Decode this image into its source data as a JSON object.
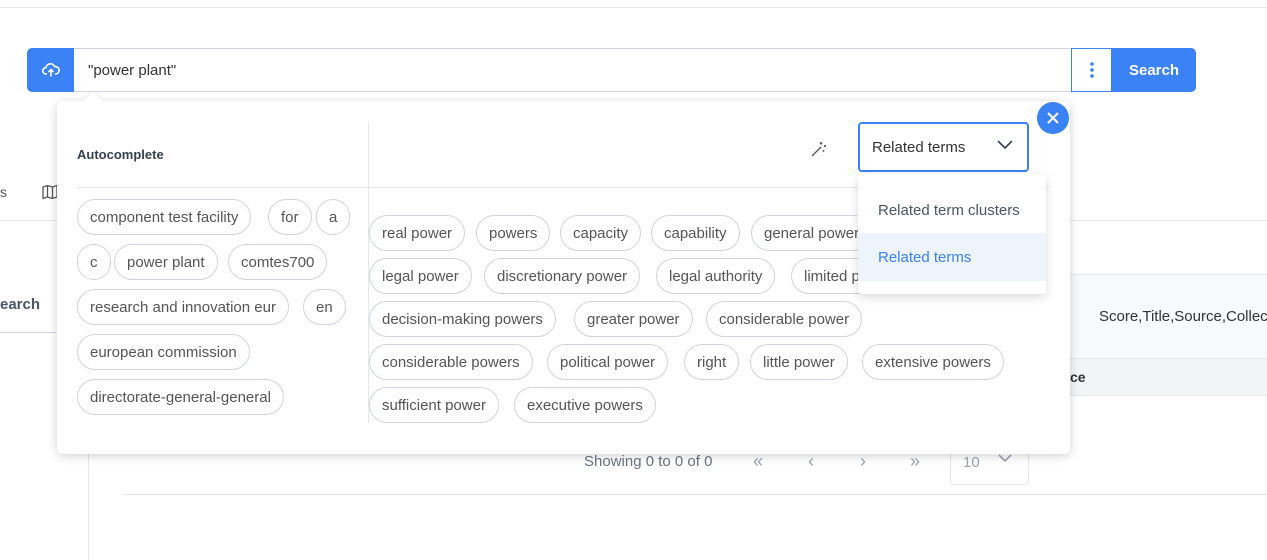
{
  "colors": {
    "accent": "#3b82f6",
    "selected_bg": "#eef4fc",
    "chip_border": "#d1d5db"
  },
  "search": {
    "query": "\"power plant\"",
    "search_label": "Search"
  },
  "icons": {
    "upload": "cloud-upload-icon",
    "kebab": "kebab-menu-icon",
    "close": "close-icon",
    "wand": "magic-wand-icon",
    "map": "map-icon",
    "chevron": "chevron-down-icon"
  },
  "popover": {
    "autocomplete_title": "Autocomplete",
    "autocomplete_terms": [
      "component test facility",
      "for",
      "a",
      "c",
      "power plant",
      "comtes700",
      "research and innovation eur",
      "en",
      "european commission",
      "directorate-general-general"
    ],
    "related_terms": [
      "real power",
      "powers",
      "capacity",
      "capability",
      "general power",
      "legal power",
      "discretionary power",
      "legal authority",
      "limited power",
      "decision-making powers",
      "greater power",
      "considerable power",
      "considerable powers",
      "political power",
      "right",
      "little power",
      "extensive powers",
      "sufficient power",
      "executive powers"
    ],
    "mode_select": {
      "selected": "Related terms",
      "options": [
        "Related term clusters",
        "Related terms"
      ]
    }
  },
  "background": {
    "tab_fragment": "s",
    "search_label_fragment": "earch",
    "columns_text": "Score,Title,Source,Collec",
    "table_header_fragment": "ce",
    "pager": {
      "status": "Showing 0 to 0 of 0",
      "page_size": "10"
    }
  }
}
